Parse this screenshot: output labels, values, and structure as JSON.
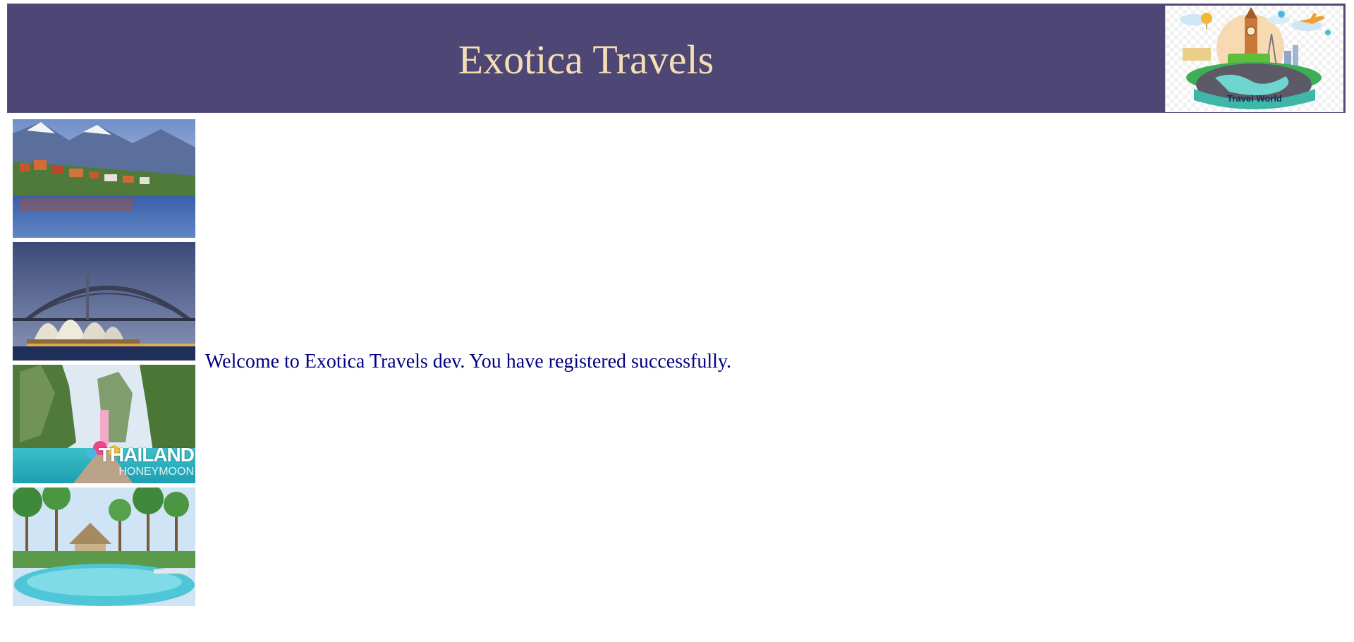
{
  "header": {
    "title": "Exotica Travels",
    "background_color": "#4e4674",
    "title_color": "#f5deb3",
    "logo": {
      "name": "travel-world-logo",
      "text": "Travel World"
    }
  },
  "photos": [
    {
      "name": "alpine-lake-village-photo",
      "overlay_title": "",
      "overlay_subtitle": ""
    },
    {
      "name": "sydney-harbour-photo",
      "overlay_title": "",
      "overlay_subtitle": ""
    },
    {
      "name": "thailand-honeymoon-photo",
      "overlay_title": "THAILAND",
      "overlay_subtitle": "HONEYMOON"
    },
    {
      "name": "tropical-resort-pool-photo",
      "overlay_title": "",
      "overlay_subtitle": ""
    }
  ],
  "main": {
    "welcome_message": "Welcome to Exotica Travels dev. You have registered successfully.",
    "welcome_color": "#000080"
  }
}
